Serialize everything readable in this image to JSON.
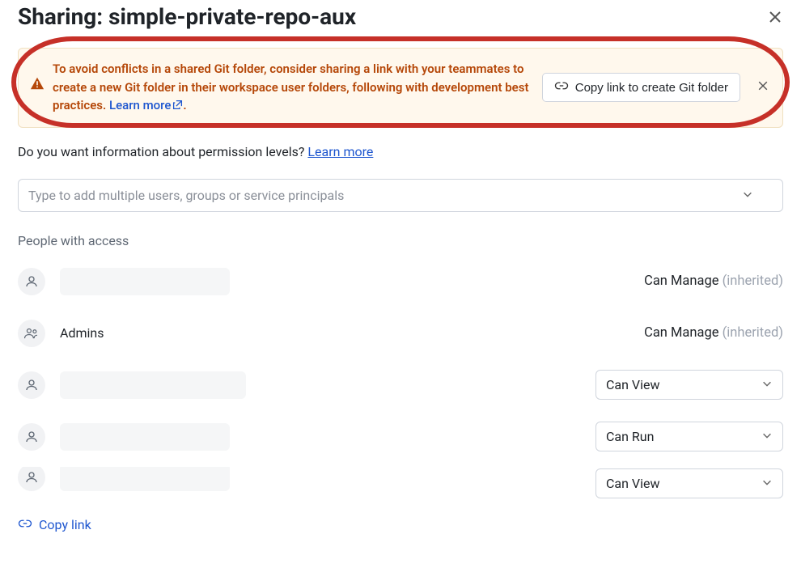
{
  "header": {
    "title": "Sharing: simple-private-repo-aux"
  },
  "banner": {
    "text_part1": "To avoid conflicts in a shared Git folder, consider sharing a link with your teammates to create a new Git folder in their workspace user folders, following with development best practices. ",
    "learn_more": "Learn more",
    "period": ".",
    "button_label": "Copy link to create Git folder"
  },
  "info_line": {
    "text": "Do you want information about permission levels? ",
    "learn_more": "Learn more"
  },
  "user_select_placeholder": "Type to add multiple users, groups or service principals",
  "section_label": "People with access",
  "access": [
    {
      "type": "user",
      "name": "",
      "redacted": true,
      "perm_type": "static",
      "perm": "Can Manage",
      "inherited": "(inherited)"
    },
    {
      "type": "group",
      "name": "Admins",
      "redacted": false,
      "perm_type": "static",
      "perm": "Can Manage",
      "inherited": "(inherited)"
    },
    {
      "type": "user",
      "name": "",
      "redacted": true,
      "perm_type": "select",
      "perm": "Can View"
    },
    {
      "type": "user",
      "name": "",
      "redacted": true,
      "perm_type": "select",
      "perm": "Can Run"
    },
    {
      "type": "user",
      "name": "",
      "redacted": true,
      "perm_type": "select",
      "perm": "Can View",
      "cut": true
    }
  ],
  "footer": {
    "copy_link": "Copy link"
  }
}
